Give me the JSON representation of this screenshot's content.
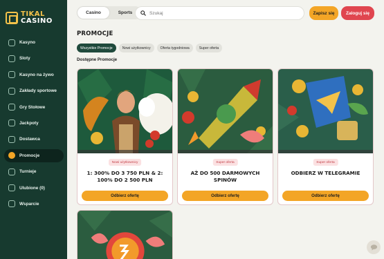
{
  "logo": {
    "line1": "TIKAL",
    "line2": "CASINO"
  },
  "sidebar": {
    "items": [
      {
        "label": "Kasyno",
        "icon": "casino-icon",
        "active": false
      },
      {
        "label": "Sloty",
        "icon": "slots-icon",
        "active": false
      },
      {
        "label": "Kasyno na żywo",
        "icon": "live-casino-icon",
        "active": false
      },
      {
        "label": "Zakłady sportowe",
        "icon": "sports-betting-icon",
        "active": false
      },
      {
        "label": "Gry Stołowe",
        "icon": "table-games-icon",
        "active": false
      },
      {
        "label": "Jackpoty",
        "icon": "jackpot-icon",
        "active": false
      },
      {
        "label": "Dostawca",
        "icon": "provider-icon",
        "active": false
      },
      {
        "label": "Promocje",
        "icon": "promotions-icon",
        "active": true
      },
      {
        "label": "Turnieje",
        "icon": "tournaments-icon",
        "active": false
      },
      {
        "label": "Ulubione (0)",
        "icon": "favorites-icon",
        "active": false
      },
      {
        "label": "Wsparcie",
        "icon": "support-icon",
        "active": false
      }
    ]
  },
  "header": {
    "toggle": {
      "casino": "Casino",
      "sports": "Sports",
      "selected": "Casino"
    },
    "search": {
      "placeholder": "Szukaj",
      "value": ""
    },
    "register_label": "Zapisz się",
    "login_label": "Zaloguj się"
  },
  "page": {
    "title": "PROMOCJE",
    "filters": [
      "Wszystkie Promocje",
      "Nowi użytkownicy",
      "Oferta tygodniowa",
      "Super oferta"
    ],
    "active_filter": "Wszystkie Promocje",
    "section_label": "Dostępne Promocje"
  },
  "promotions": [
    {
      "badge": "Nowi użytkownicy",
      "title": "1: 300% DO 3 750 PLN & 2: 100% DO 2 500 PLN",
      "button": "Odbierz ofertę"
    },
    {
      "badge": "Super oferta",
      "title": "AŻ DO 500 DARMOWYCH SPINÓW",
      "button": "Odbierz ofertę"
    },
    {
      "badge": "Super oferta",
      "title": "ODBIERZ W TELEGRAMIE",
      "button": "Odbierz ofertę"
    }
  ],
  "colors": {
    "sidebar_bg": "#173a2f",
    "accent_yellow": "#f3a526",
    "accent_red": "#e0464f",
    "chip_active": "#1f4a3c"
  }
}
